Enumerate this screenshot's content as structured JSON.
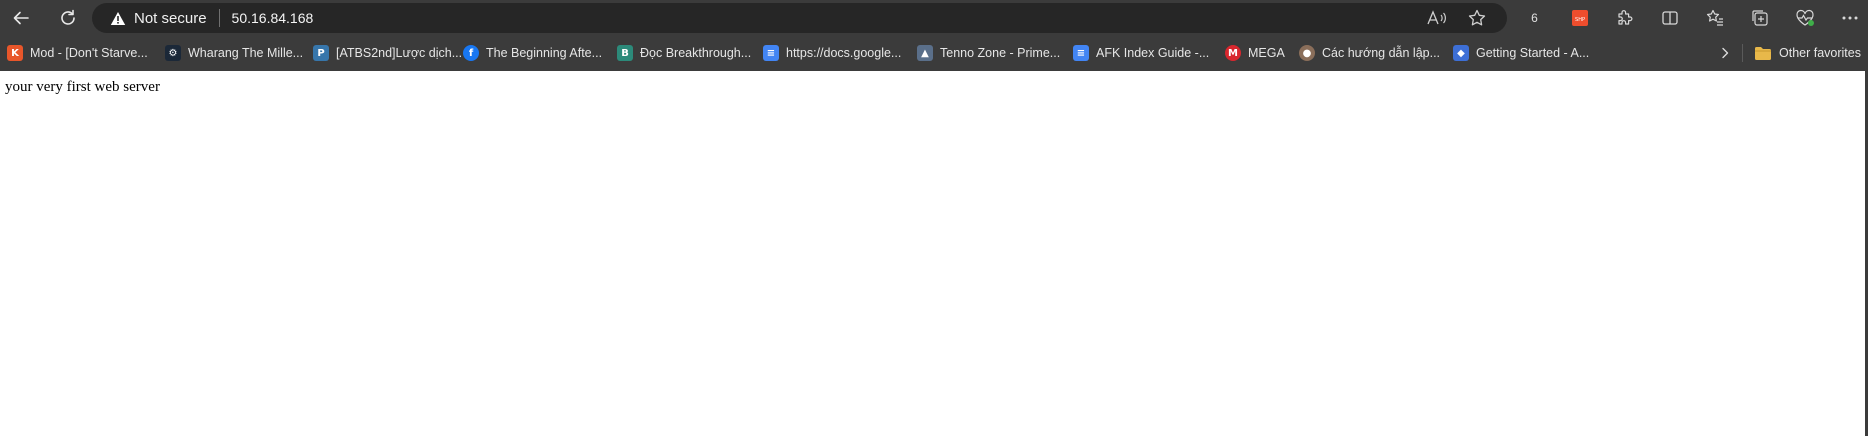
{
  "address_bar": {
    "security_label": "Not secure",
    "url": "50.16.84.168"
  },
  "toolbar": {
    "profile_badge": "6"
  },
  "bookmarks": [
    {
      "label": "Mod - [Don't Starve...",
      "icon": "k-logo-icon",
      "color": "#e8562a",
      "glyph": "K"
    },
    {
      "label": "Wharang The Mille...",
      "icon": "steam-icon",
      "color": "#1b2838",
      "glyph": "⚙"
    },
    {
      "label": "[ATBS2nd]Lược dịch...",
      "icon": "python-icon",
      "color": "#3776ab",
      "glyph": "P"
    },
    {
      "label": "The Beginning Afte...",
      "icon": "facebook-icon",
      "color": "#1877f2",
      "glyph": "f"
    },
    {
      "label": "Đọc Breakthrough...",
      "icon": "book-site-icon",
      "color": "#2c8a7a",
      "glyph": "B"
    },
    {
      "label": "https://docs.google...",
      "icon": "google-docs-icon",
      "color": "#4285f4",
      "glyph": "≡"
    },
    {
      "label": "Tenno Zone - Prime...",
      "icon": "tenno-zone-icon",
      "color": "#5a6f8a",
      "glyph": "▲"
    },
    {
      "label": "AFK Index Guide -...",
      "icon": "google-docs-icon",
      "color": "#4285f4",
      "glyph": "≡"
    },
    {
      "label": "MEGA",
      "icon": "mega-icon",
      "color": "#d9272e",
      "glyph": "M"
    },
    {
      "label": "Các hướng dẫn lập...",
      "icon": "avatar-site-icon",
      "color": "#8a6e5a",
      "glyph": "●"
    },
    {
      "label": "Getting Started - A...",
      "icon": "diamond-site-icon",
      "color": "#3d6fd6",
      "glyph": "◆"
    }
  ],
  "other_favorites": {
    "label": "Other favorites",
    "icon": "folder-icon",
    "color": "#e8b84a"
  },
  "page": {
    "body_text": "your very first web server"
  }
}
